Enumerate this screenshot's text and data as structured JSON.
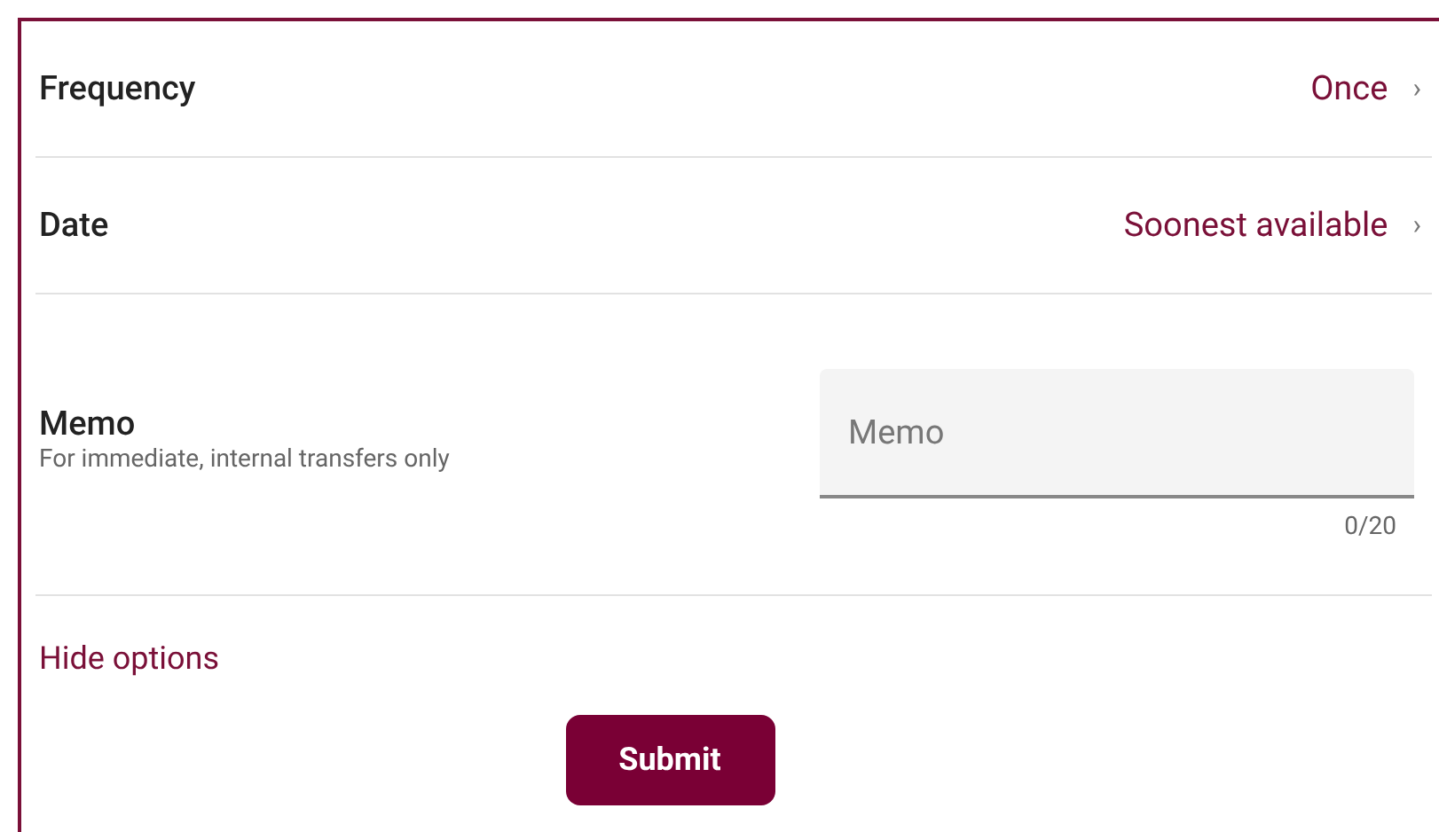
{
  "options": [
    {
      "label": "Frequency",
      "value": "Once",
      "chevron": "›"
    },
    {
      "label": "Date",
      "value": "Soonest available",
      "chevron": "›"
    }
  ],
  "memo": {
    "label": "Memo",
    "hint": "For immediate, internal transfers only",
    "placeholder": "Memo",
    "counter": "0/20"
  },
  "toggle_link": "Hide options",
  "submit": "Submit"
}
